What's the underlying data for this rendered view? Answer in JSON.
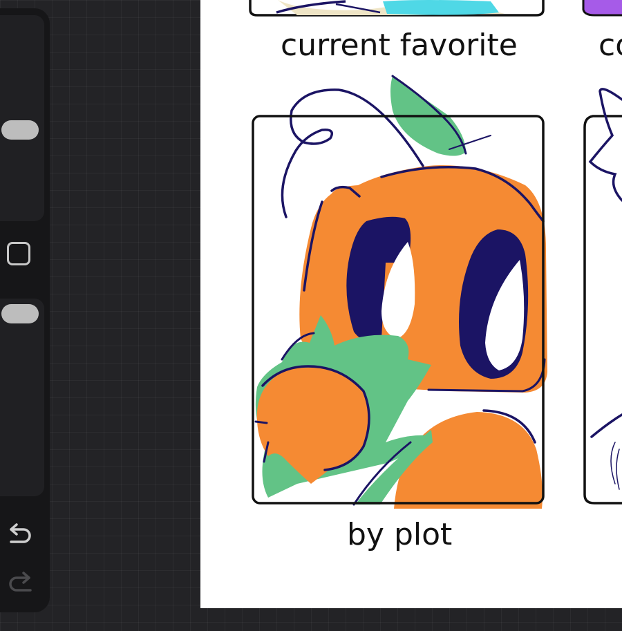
{
  "sidebar": {
    "brush_size_slider": {
      "level": 0.55
    },
    "opacity_slider": {
      "level": 0.95
    },
    "modify_button_icon": "square-icon",
    "undo_icon": "undo-arrow-icon",
    "redo_icon": "redo-arrow-icon"
  },
  "canvas": {
    "captions": {
      "top_middle": "current favorite",
      "top_right_partial": "co",
      "bottom_middle": "by plot"
    }
  },
  "colors": {
    "orange": "#F58A33",
    "navy": "#1B1464",
    "green": "#62C386",
    "cyan": "#4FD8E6",
    "purple": "#A65BE8"
  }
}
